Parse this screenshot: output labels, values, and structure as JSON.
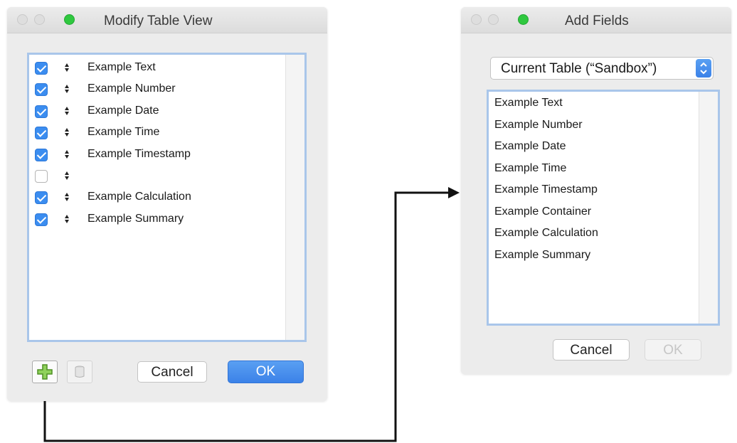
{
  "modify_dialog": {
    "title": "Modify Table View",
    "rows": [
      {
        "checked": true,
        "label": "Example Text"
      },
      {
        "checked": true,
        "label": "Example Number"
      },
      {
        "checked": true,
        "label": "Example Date"
      },
      {
        "checked": true,
        "label": "Example Time"
      },
      {
        "checked": true,
        "label": "Example Timestamp"
      },
      {
        "checked": false,
        "label": ""
      },
      {
        "checked": true,
        "label": "Example Calculation"
      },
      {
        "checked": true,
        "label": "Example Summary"
      }
    ],
    "cancel_label": "Cancel",
    "ok_label": "OK"
  },
  "add_fields_dialog": {
    "title": "Add Fields",
    "table_select": "Current Table (“Sandbox”)",
    "fields": [
      "Example Text",
      "Example Number",
      "Example Date",
      "Example Time",
      "Example Timestamp",
      "Example Container",
      "Example Calculation",
      "Example Summary"
    ],
    "cancel_label": "Cancel",
    "ok_label": "OK"
  },
  "icons": {
    "add_field": "plus-icon",
    "delete_field": "trash-icon",
    "reorder": "drag-handle-icon",
    "select_arrows": "up-down-arrows-icon"
  },
  "colors": {
    "accent": "#3b82e8",
    "list_focus": "#a9c6ea",
    "green_light": "#2fc83f",
    "plus_icon": "#6fb83a"
  }
}
